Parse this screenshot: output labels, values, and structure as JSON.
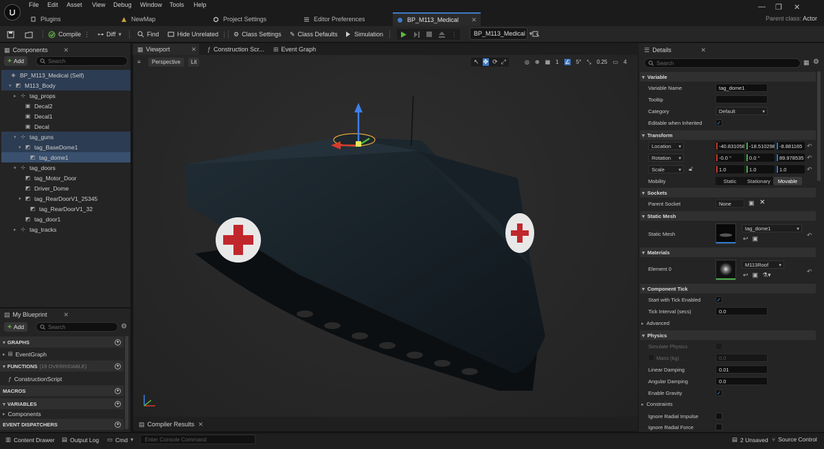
{
  "menu": [
    "File",
    "Edit",
    "Asset",
    "View",
    "Debug",
    "Window",
    "Tools",
    "Help"
  ],
  "doc_tabs": [
    {
      "label": "Plugins",
      "icon": "plug-icon"
    },
    {
      "label": "NewMap",
      "icon": "map-icon"
    },
    {
      "label": "Project Settings",
      "icon": "gear-icon"
    },
    {
      "label": "Editor Preferences",
      "icon": "sliders-icon"
    },
    {
      "label": "BP_M113_Medical",
      "icon": "blueprint-icon"
    }
  ],
  "parent_class": {
    "label": "Parent class:",
    "value": "Actor"
  },
  "toolbar": {
    "compile": "Compile",
    "diff": "Diff",
    "find": "Find",
    "hide_unrelated": "Hide Unrelated",
    "class_settings": "Class Settings",
    "class_defaults": "Class Defaults",
    "simulation": "Simulation",
    "debug_object": "BP_M113_Medical"
  },
  "components": {
    "tab": "Components",
    "add": "Add",
    "search_placeholder": "Search",
    "items": [
      {
        "label": "BP_M113_Medical (Self)",
        "depth": 0,
        "state": "sel",
        "icon": "actor-icon",
        "arrow": ""
      },
      {
        "label": "M113_Body",
        "depth": 1,
        "state": "sel",
        "icon": "static-mesh-icon",
        "arrow": "▾"
      },
      {
        "label": "tag_props",
        "depth": 2,
        "state": "",
        "icon": "scene-icon",
        "arrow": "▸"
      },
      {
        "label": "Decal2",
        "depth": 3,
        "state": "",
        "icon": "decal-icon",
        "arrow": ""
      },
      {
        "label": "Decal1",
        "depth": 3,
        "state": "",
        "icon": "decal-icon",
        "arrow": ""
      },
      {
        "label": "Decal",
        "depth": 3,
        "state": "",
        "icon": "decal-icon",
        "arrow": ""
      },
      {
        "label": "tag_guns",
        "depth": 2,
        "state": "sel",
        "icon": "scene-icon",
        "arrow": "▾"
      },
      {
        "label": "tag_BaseDome1",
        "depth": 3,
        "state": "sel",
        "icon": "static-mesh-icon",
        "arrow": "▾"
      },
      {
        "label": "tag_dome1",
        "depth": 4,
        "state": "selstrong",
        "icon": "static-mesh-icon",
        "arrow": ""
      },
      {
        "label": "tag_doors",
        "depth": 2,
        "state": "",
        "icon": "scene-icon",
        "arrow": "▾"
      },
      {
        "label": "tag_Motor_Door",
        "depth": 3,
        "state": "",
        "icon": "static-mesh-icon",
        "arrow": ""
      },
      {
        "label": "Driver_Dome",
        "depth": 3,
        "state": "",
        "icon": "static-mesh-icon",
        "arrow": ""
      },
      {
        "label": "tag_RearDoorV1_25345",
        "depth": 3,
        "state": "",
        "icon": "static-mesh-icon",
        "arrow": "▾"
      },
      {
        "label": "tag_RearDoorV1_32",
        "depth": 4,
        "state": "",
        "icon": "static-mesh-icon",
        "arrow": ""
      },
      {
        "label": "tag_door1",
        "depth": 3,
        "state": "",
        "icon": "static-mesh-icon",
        "arrow": ""
      },
      {
        "label": "tag_tracks",
        "depth": 2,
        "state": "",
        "icon": "scene-icon",
        "arrow": "▸"
      }
    ]
  },
  "my_blueprint": {
    "tab": "My Blueprint",
    "add": "Add",
    "search_placeholder": "Search",
    "graphs": "GRAPHS",
    "event_graph": "EventGraph",
    "functions": "FUNCTIONS",
    "functions_sub": "(19 OVERRIDABLE)",
    "construction_script": "ConstructionScript",
    "macros": "MACROS",
    "variables": "VARIABLES",
    "components": "Components",
    "event_dispatchers": "EVENT DISPATCHERS"
  },
  "editor_tabs": [
    "Viewport",
    "Construction Scr...",
    "Event Graph"
  ],
  "viewport": {
    "perspective": "Perspective",
    "lit": "Lit",
    "grid_size": "1",
    "rotation_snap": "5°",
    "scale_snap": "0.25",
    "camera_speed": "4"
  },
  "compiler_results": "Compiler Results",
  "details": {
    "tab": "Details",
    "search_placeholder": "Search",
    "sections": {
      "variable": "Variable",
      "transform": "Transform",
      "sockets": "Sockets",
      "static_mesh": "Static Mesh",
      "materials": "Materials",
      "component_tick": "Component Tick",
      "advanced": "Advanced",
      "physics": "Physics",
      "constraints": "Constraints"
    },
    "variable_name_label": "Variable Name",
    "variable_name": "tag_dome1",
    "tooltip_label": "Tooltip",
    "tooltip_value": "",
    "category_label": "Category",
    "category": "Default",
    "editable_label": "Editable when Inherited",
    "location_label": "Location",
    "location": [
      "-40.831058",
      "-18.510298",
      "-8.881165"
    ],
    "rotation_label": "Rotation",
    "rotation": [
      "-0.0 °",
      "0.0 °",
      "89.978535"
    ],
    "scale_label": "Scale",
    "scale": [
      "1.0",
      "1.0",
      "1.0"
    ],
    "mobility_label": "Mobility",
    "mobility": [
      "Static",
      "Stationary",
      "Movable"
    ],
    "parent_socket_label": "Parent Socket",
    "parent_socket": "None",
    "static_mesh_label": "Static Mesh",
    "static_mesh": "tag_dome1",
    "element0_label": "Element 0",
    "element0": "M113Roof",
    "start_tick_label": "Start with Tick Enabled",
    "tick_interval_label": "Tick Interval (secs)",
    "tick_interval": "0.0",
    "simulate_physics_label": "Simulate Physics",
    "mass_label": "Mass (kg)",
    "mass": "0.0",
    "linear_damping_label": "Linear Damping",
    "linear_damping": "0.01",
    "angular_damping_label": "Angular Damping",
    "angular_damping": "0.0",
    "enable_gravity_label": "Enable Gravity",
    "ignore_radial_impulse_label": "Ignore Radial Impulse",
    "ignore_radial_force_label": "Ignore Radial Force"
  },
  "status": {
    "content_drawer": "Content Drawer",
    "output_log": "Output Log",
    "cmd": "Cmd",
    "console_placeholder": "Enter Console Command",
    "unsaved": "2 Unsaved",
    "source_control": "Source Control"
  },
  "colors": {
    "accent": "#3d7cc9",
    "play": "#5dbb3a",
    "add": "#64c23d",
    "selection": "#39506e"
  }
}
